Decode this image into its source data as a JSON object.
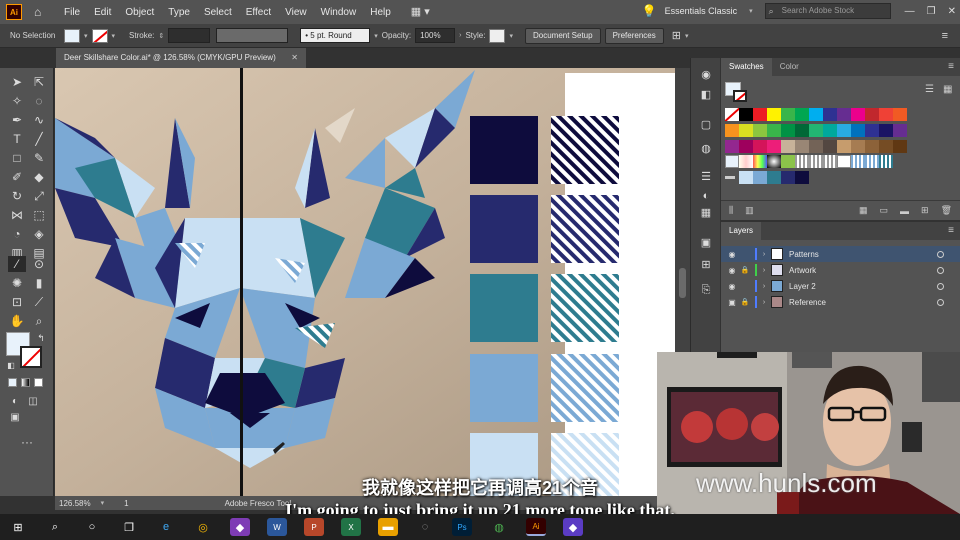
{
  "app": {
    "logo": "Ai",
    "menu": [
      "File",
      "Edit",
      "Object",
      "Type",
      "Select",
      "Effect",
      "View",
      "Window",
      "Help"
    ],
    "workspace": "Essentials Classic",
    "search_placeholder": "Search Adobe Stock"
  },
  "control": {
    "selection": "No Selection",
    "stroke_label": "Stroke:",
    "brush": "5 pt. Round",
    "opacity_label": "Opacity:",
    "opacity_value": "100%",
    "style_label": "Style:",
    "doc_setup": "Document Setup",
    "preferences": "Preferences"
  },
  "document": {
    "tab_title": "Deer Skillshare Color.ai* @ 126.58% (CMYK/GPU Preview)",
    "zoom": "126.58%",
    "artboard": "1",
    "status": "Adobe Fresco Tool"
  },
  "swatches_panel": {
    "tabs": [
      "Swatches",
      "Color"
    ],
    "active_tab": "Swatches",
    "colors": {
      "row1": [
        "#ffffff",
        "#000000",
        "#ed1c24",
        "#fff200",
        "#39b54a",
        "#00a651",
        "#00aeef",
        "#2e3192",
        "#662d91",
        "#ec008c",
        "#c1272d",
        "#ef4136",
        "#f15a24"
      ],
      "row2": [
        "#f7931e",
        "#d9e021",
        "#8cc63f",
        "#39b54a",
        "#009245",
        "#006837",
        "#22b573",
        "#00a99d",
        "#29abe2",
        "#0071bc",
        "#2e3192",
        "#1b1464",
        "#662d91"
      ],
      "row3": [
        "#93278f",
        "#9e005d",
        "#d4145a",
        "#ed1e79",
        "#c7b299",
        "#998675",
        "#736357",
        "#534741",
        "#c69c6d",
        "#a67c52",
        "#8c6239",
        "#754c24",
        "#603813"
      ]
    }
  },
  "layers_panel": {
    "title": "Layers",
    "layers": [
      {
        "name": "Patterns",
        "color": "#4f7cff",
        "locked": false,
        "selected": true
      },
      {
        "name": "Artwork",
        "color": "#3fd14a",
        "locked": true,
        "selected": false
      },
      {
        "name": "Layer 2",
        "color": "#4f7cff",
        "locked": false,
        "selected": false
      },
      {
        "name": "Reference",
        "color": "#4f7cff",
        "locked": true,
        "selected": false
      }
    ]
  },
  "palette": {
    "solid": [
      "#0e0c3d",
      "#262a6e",
      "#2e7c8f",
      "#7ba9d4",
      "#c9e0f3"
    ]
  },
  "subtitle": {
    "cn": "我就像这样把它再调高21个音",
    "en": "I'm going to just bring it up 21 more tone like that."
  },
  "watermark": "www.hunls.com"
}
